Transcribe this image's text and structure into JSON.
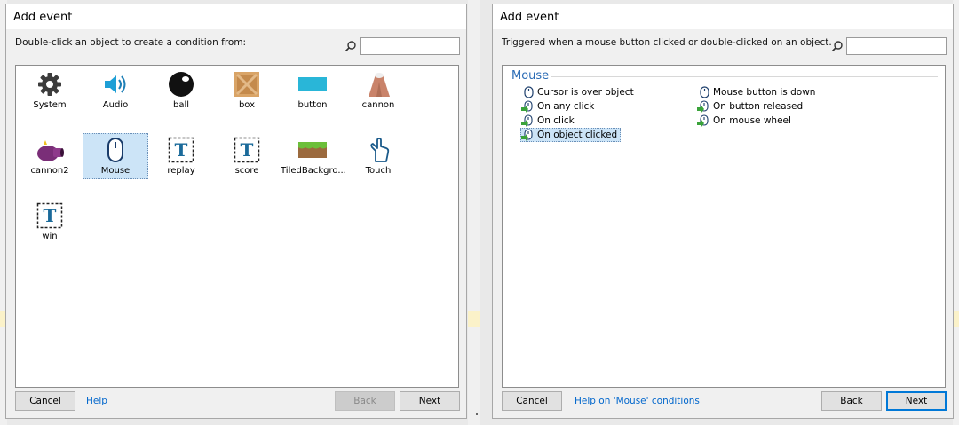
{
  "left_dialog": {
    "title": "Add event",
    "description": "Double-click an object to create a condition from:",
    "search_value": "",
    "objects": [
      {
        "label": "System",
        "icon": "gear-icon"
      },
      {
        "label": "Audio",
        "icon": "speaker-icon"
      },
      {
        "label": "ball",
        "icon": "ball-icon"
      },
      {
        "label": "box",
        "icon": "crate-icon"
      },
      {
        "label": "button",
        "icon": "button-rect-icon"
      },
      {
        "label": "cannon",
        "icon": "cannon-icon"
      },
      {
        "label": "cannon2",
        "icon": "cannon2-icon"
      },
      {
        "label": "Mouse",
        "icon": "mouse-icon",
        "selected": true
      },
      {
        "label": "replay",
        "icon": "text-object-icon"
      },
      {
        "label": "score",
        "icon": "text-object-icon"
      },
      {
        "label": "TiledBackgro...",
        "icon": "tiled-background-icon"
      },
      {
        "label": "Touch",
        "icon": "touch-icon"
      },
      {
        "label": "win",
        "icon": "text-object-icon"
      }
    ],
    "footer": {
      "cancel": "Cancel",
      "help": "Help",
      "back": "Back",
      "next": "Next"
    }
  },
  "right_dialog": {
    "title": "Add event",
    "description": "Triggered when a mouse button clicked or double-clicked on an object.",
    "search_value": "",
    "group_title": "Mouse",
    "conditions_left": [
      {
        "label": "Cursor is over object",
        "icon": "mouse-icon"
      },
      {
        "label": "On any click",
        "icon": "mouse-trigger-icon"
      },
      {
        "label": "On click",
        "icon": "mouse-trigger-icon"
      },
      {
        "label": "On object clicked",
        "icon": "mouse-trigger-icon",
        "selected": true
      }
    ],
    "conditions_right": [
      {
        "label": "Mouse button is down",
        "icon": "mouse-icon"
      },
      {
        "label": "On button released",
        "icon": "mouse-trigger-icon"
      },
      {
        "label": "On mouse wheel",
        "icon": "mouse-trigger-icon"
      }
    ],
    "footer": {
      "cancel": "Cancel",
      "help": "Help on 'Mouse' conditions",
      "back": "Back",
      "next": "Next"
    }
  },
  "colors": {
    "accent": "#0078d7",
    "selection": "#cce4f7",
    "group_title": "#2a6bb5",
    "link": "#0066cc"
  }
}
